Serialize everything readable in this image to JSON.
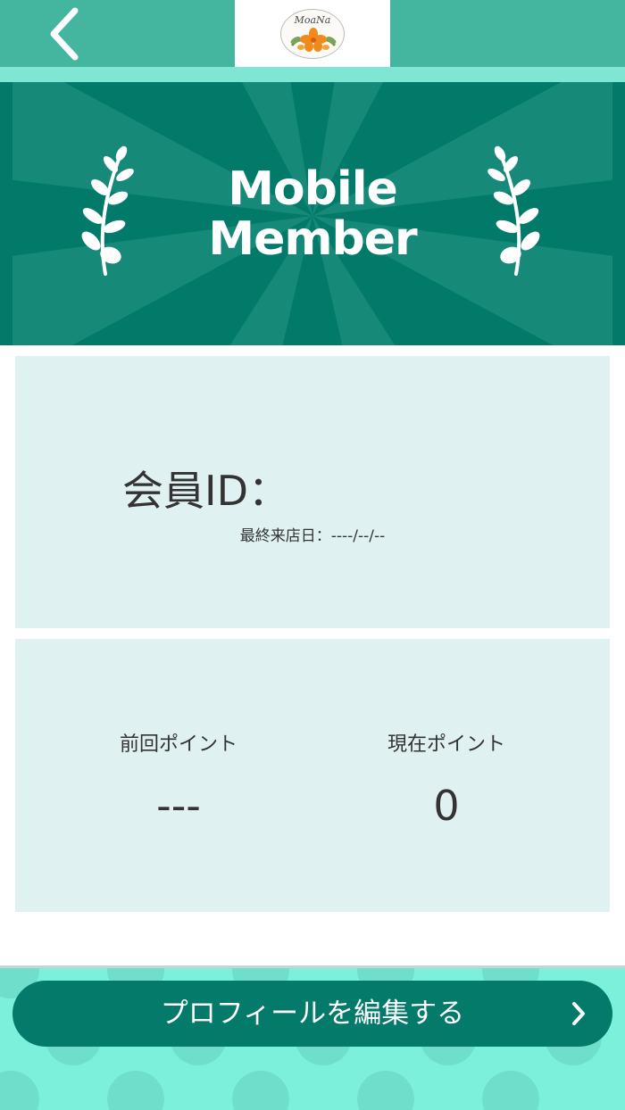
{
  "header": {
    "back_icon": "chevron-left-icon",
    "logo_text": "MoaNa",
    "colors": {
      "header": "#44b59f",
      "stripe": "#7fe6d3"
    }
  },
  "banner": {
    "title_line1": "Mobile",
    "title_line2": "Member",
    "colors": {
      "background": "#017a6a",
      "rays": "#1f8f7f"
    }
  },
  "member": {
    "id_label": "会員ID：",
    "last_visit": "最終来店日：----/--/--"
  },
  "points": {
    "previous_label": "前回ポイント",
    "previous_value": "---",
    "current_label": "現在ポイント",
    "current_value": "0"
  },
  "footer": {
    "edit_profile_label": "プロフィールを編集する",
    "colors": {
      "button": "#037a6a",
      "background": "#7df0dc"
    }
  }
}
